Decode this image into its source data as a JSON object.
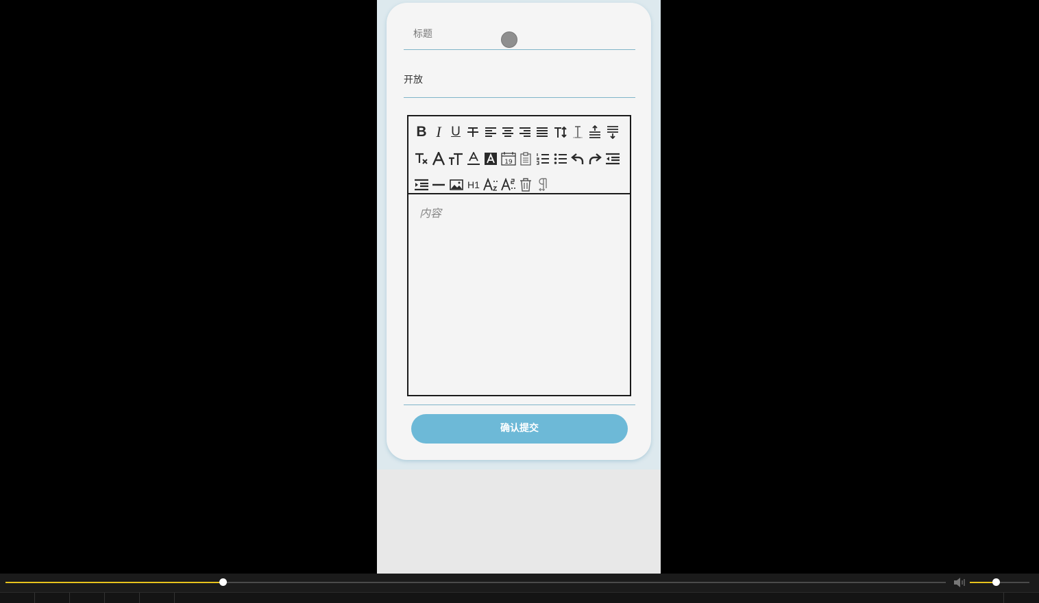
{
  "form": {
    "title_placeholder": "标题",
    "visibility_value": "开放",
    "content_placeholder": "内容",
    "submit_label": "确认提交"
  },
  "toolbar": {
    "rows": [
      [
        "bold",
        "italic",
        "underline",
        "strikethrough",
        "align-left",
        "align-center",
        "align-right",
        "align-justify",
        "font-size",
        "line-height",
        "paragraph-spacing-top",
        "paragraph-spacing-bottom"
      ],
      [
        "remove-format",
        "font-name",
        "text-case",
        "text-color",
        "background-color",
        "insert-date",
        "paste-text",
        "ordered-list",
        "unordered-list",
        "undo",
        "redo",
        "outdent"
      ],
      [
        "indent",
        "horizontal-rule",
        "insert-image",
        "heading",
        "subscript",
        "superscript",
        "clear-all",
        "show-paragraph-marks"
      ]
    ],
    "labels": {
      "bold": "B",
      "italic": "I",
      "underline": "U",
      "heading": "H1",
      "date_day": "19"
    }
  },
  "player": {
    "progress_fraction": 0.231,
    "volume_fraction": 0.44,
    "accent_color": "#e6c21d"
  },
  "colors": {
    "submit_bg": "#6db9d7",
    "field_underline": "#7fb4c8",
    "card_bg": "#f5f5f5"
  }
}
